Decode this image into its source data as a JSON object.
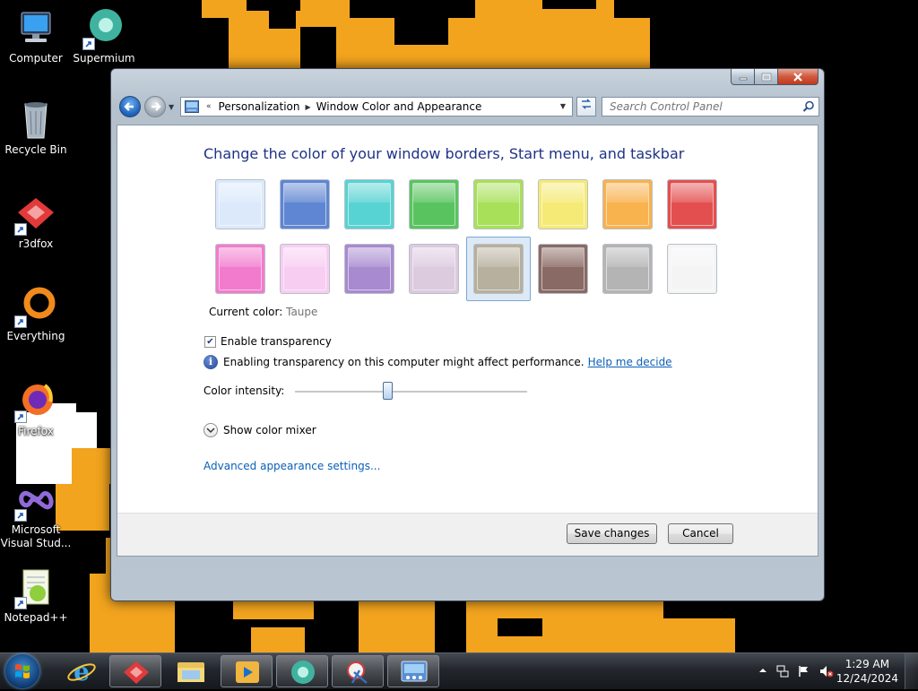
{
  "desktop": {
    "icons": [
      {
        "label": "Computer",
        "icon": "computer-icon"
      },
      {
        "label": "Supermium",
        "icon": "supermium-icon"
      },
      {
        "label": "Recycle Bin",
        "icon": "recycle-bin-icon"
      },
      {
        "label": "r3dfox",
        "icon": "r3dfox-icon"
      },
      {
        "label": "Everything",
        "icon": "everything-icon"
      },
      {
        "label": "Firefox",
        "icon": "firefox-icon"
      },
      {
        "label": "Microsoft Visual Stud...",
        "icon": "visual-studio-icon"
      },
      {
        "label": "Notepad++",
        "icon": "notepadpp-icon"
      }
    ]
  },
  "window": {
    "breadcrumb": {
      "prefix": "«",
      "items": [
        "Personalization",
        "Window Color and Appearance"
      ]
    },
    "search_placeholder": "Search Control Panel",
    "heading": "Change the color of your window borders, Start menu, and taskbar",
    "swatches": [
      {
        "name": "Sky",
        "color": "#dbe9fb"
      },
      {
        "name": "Twilight",
        "color": "#5f86d2"
      },
      {
        "name": "Sea",
        "color": "#58d3d3"
      },
      {
        "name": "Leaf",
        "color": "#59c45f"
      },
      {
        "name": "Lime",
        "color": "#a9e05a"
      },
      {
        "name": "Lemon",
        "color": "#f5ea76"
      },
      {
        "name": "Pumpkin",
        "color": "#f8b24e"
      },
      {
        "name": "Ruby",
        "color": "#e34f4f"
      },
      {
        "name": "Fuchsia",
        "color": "#f27bcd"
      },
      {
        "name": "Blush",
        "color": "#f7cdf2"
      },
      {
        "name": "Violet",
        "color": "#a88ad0"
      },
      {
        "name": "Lavender",
        "color": "#dccadf"
      },
      {
        "name": "Taupe",
        "color": "#b7b09e",
        "selected": true
      },
      {
        "name": "Chocolate",
        "color": "#8a6a64"
      },
      {
        "name": "Slate",
        "color": "#b4b4b4"
      },
      {
        "name": "Frost",
        "color": "#f4f4f4"
      }
    ],
    "current_color_label": "Current color:",
    "current_color_value": "Taupe",
    "enable_transparency_label": "Enable transparency",
    "enable_transparency_checked": true,
    "transparency_info": "Enabling transparency on this computer might affect performance.",
    "help_link": "Help me decide",
    "color_intensity_label": "Color intensity:",
    "color_intensity_fraction": 0.4,
    "show_color_mixer": "Show color mixer",
    "advanced_link": "Advanced appearance settings...",
    "save_button": "Save changes",
    "cancel_button": "Cancel"
  },
  "taskbar": {
    "items": [
      "internet-explorer-icon",
      "r3dfox-icon",
      "file-explorer-icon",
      "media-player-icon",
      "supermium-icon",
      "snipping-tool-icon",
      "control-panel-icon"
    ],
    "active_item": "control-panel-icon",
    "time": "1:29 AM",
    "date": "12/24/2024"
  },
  "colors": {
    "heading": "#1e3287",
    "link": "#0b5fb8",
    "wallpaper_orange": "#f2a41e"
  }
}
